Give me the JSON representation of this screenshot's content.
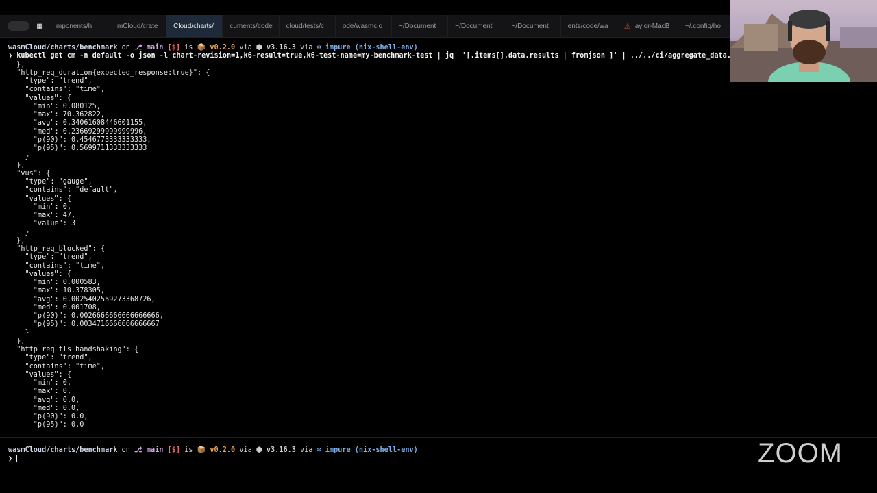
{
  "tabs": [
    {
      "label": "mponents/h"
    },
    {
      "label": "mCloud/crate"
    },
    {
      "label": "Cloud/charts/"
    },
    {
      "label": "cuments/code"
    },
    {
      "label": "cloud/tests/c"
    },
    {
      "label": "ode/wasmclo"
    },
    {
      "label": "~/Document"
    },
    {
      "label": "~/Document"
    },
    {
      "label": "~/Document"
    },
    {
      "label": "ents/code/wa"
    },
    {
      "label": "aylor-MacB"
    },
    {
      "label": "~/.config/ho"
    }
  ],
  "prompt": {
    "dir": "wasmCloud/charts/benchmark",
    "on": " on ",
    "branch_icon": "⎇",
    "branch": "main",
    "status": "[$]",
    "is": " is ",
    "pkg_icon": "📦",
    "version": "v0.2.0",
    "via1": " via ",
    "node_icon": "⬢",
    "node_version": "v3.16.3",
    "via2": " via ",
    "nix_icon": "❄",
    "nix": "impure (nix-shell-env)"
  },
  "command": {
    "chevron": "❯",
    "text": " kubectl get cm -n default -o json -l chart-revision=1,k6-result=true,k6-test-name=my-benchmark-test | jq  '[.items[].data.results | fromjson ]' | ../../ci/aggregate_data."
  },
  "output": [
    "  },",
    "  \"http_req_duration{expected_response:true}\": {",
    "    \"type\": \"trend\",",
    "    \"contains\": \"time\",",
    "    \"values\": {",
    "      \"min\": 0.080125,",
    "      \"max\": 70.362822,",
    "      \"avg\": 0.34061608446601155,",
    "      \"med\": 0.23669299999999996,",
    "      \"p(90)\": 0.4546773333333333,",
    "      \"p(95)\": 0.5699711333333333",
    "    }",
    "  },",
    "  \"vus\": {",
    "    \"type\": \"gauge\",",
    "    \"contains\": \"default\",",
    "    \"values\": {",
    "      \"min\": 0,",
    "      \"max\": 47,",
    "      \"value\": 3",
    "    }",
    "  },",
    "  \"http_req_blocked\": {",
    "    \"type\": \"trend\",",
    "    \"contains\": \"time\",",
    "    \"values\": {",
    "      \"min\": 0.000583,",
    "      \"max\": 10.378305,",
    "      \"avg\": 0.0025402559273368726,",
    "      \"med\": 0.001708,",
    "      \"p(90)\": 0.0026666666666666666,",
    "      \"p(95)\": 0.0034716666666666667",
    "    }",
    "  },",
    "  \"http_req_tls_handshaking\": {",
    "    \"type\": \"trend\",",
    "    \"contains\": \"time\",",
    "    \"values\": {",
    "      \"min\": 0,",
    "      \"max\": 0,",
    "      \"avg\": 0.0,",
    "      \"med\": 0.0,",
    "      \"p(90)\": 0.0,",
    "      \"p(95)\": 0.0"
  ],
  "prompt_chevron": "❯",
  "zoom_logo": "ZOOM"
}
